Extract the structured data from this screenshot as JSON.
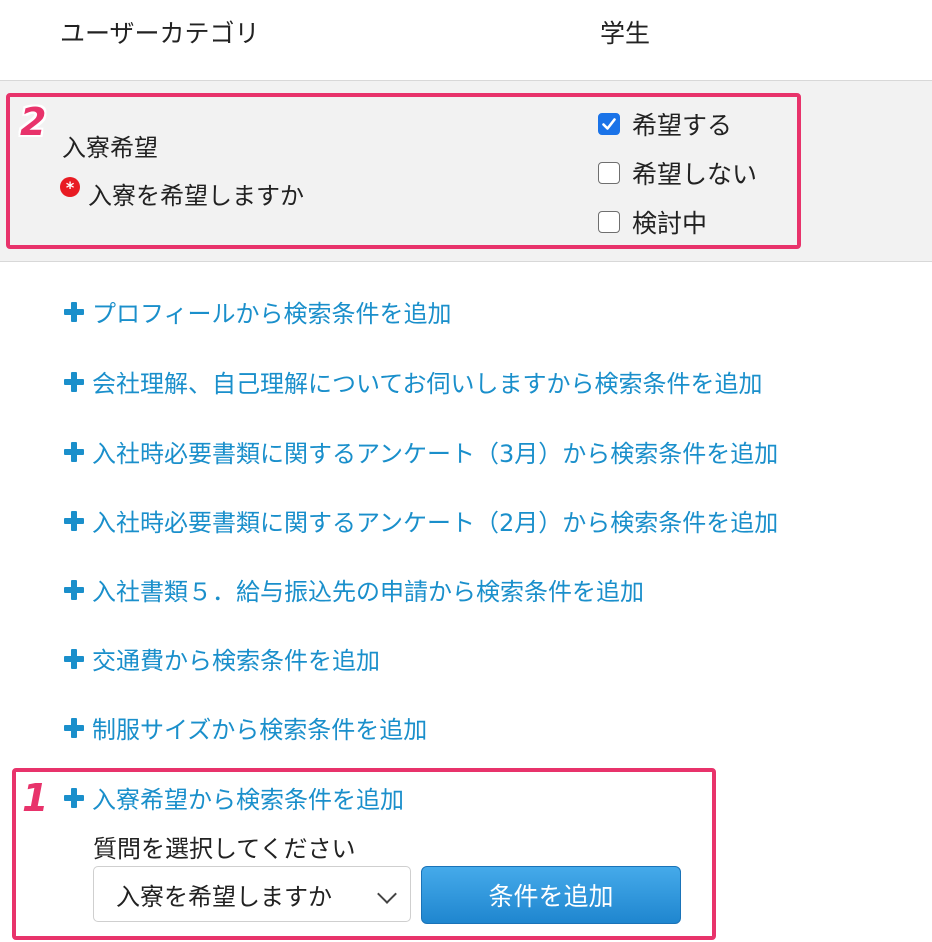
{
  "category": {
    "label": "ユーザーカテゴリ",
    "value": "学生"
  },
  "question": {
    "title": "入寮希望",
    "required_mark": "*",
    "text": "入寮を希望しますか",
    "options": [
      {
        "label": "希望する",
        "checked": true
      },
      {
        "label": "希望しない",
        "checked": false
      },
      {
        "label": "検討中",
        "checked": false
      }
    ]
  },
  "badges": {
    "first": "1",
    "second": "2"
  },
  "add_links": [
    "プロフィールから検索条件を追加",
    "会社理解、自己理解についてお伺いしますから検索条件を追加",
    "入社時必要書類に関するアンケート（3月）から検索条件を追加",
    "入社時必要書類に関するアンケート（2月）から検索条件を追加",
    "入社書類５．給与振込先の申請から検索条件を追加",
    "交通費から検索条件を追加",
    "制服サイズから検索条件を追加",
    "入寮希望から検索条件を追加"
  ],
  "selector": {
    "label": "質問を選択してください",
    "selected": "入寮を希望しますか",
    "button_label": "条件を追加"
  },
  "colors": {
    "accent": "#1a8fcb",
    "highlight": "#e8336b",
    "checkbox": "#1a73e8"
  }
}
